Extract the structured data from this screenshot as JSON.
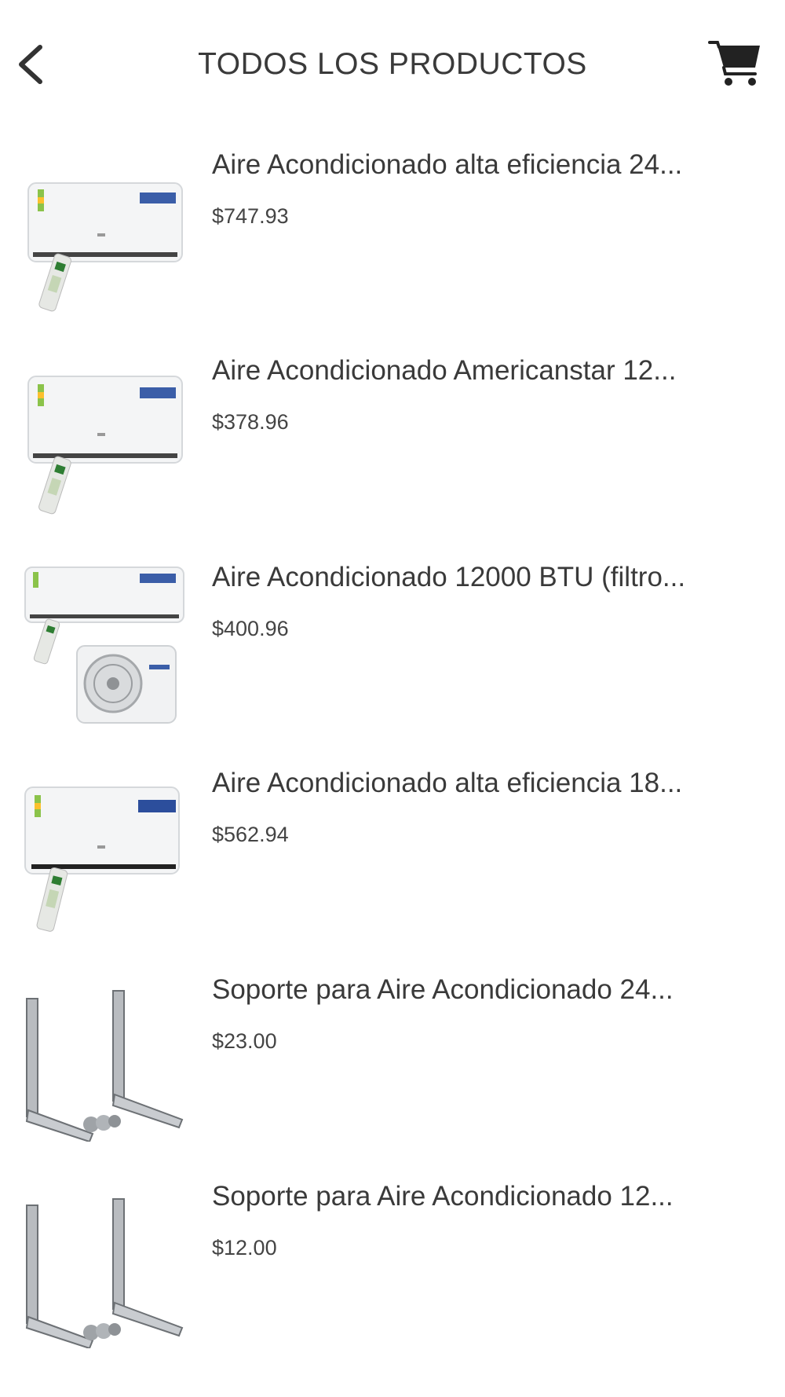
{
  "header": {
    "title": "TODOS LOS PRODUCTOS",
    "back_icon": "chevron-left-icon",
    "cart_icon": "cart-icon"
  },
  "products": [
    {
      "name": "Aire Acondicionado alta eficiencia 24...",
      "price": "$747.93",
      "image": "split-ac-with-remote"
    },
    {
      "name": "Aire Acondicionado Americanstar 12...",
      "price": "$378.96",
      "image": "split-ac-with-remote"
    },
    {
      "name": "Aire Acondicionado 12000 BTU (filtro...",
      "price": "$400.96",
      "image": "split-ac-with-outdoor-unit"
    },
    {
      "name": "Aire Acondicionado alta eficiencia 18...",
      "price": "$562.94",
      "image": "split-ac-with-remote"
    },
    {
      "name": "Soporte para Aire Acondicionado 24...",
      "price": "$23.00",
      "image": "wall-mount-brackets"
    },
    {
      "name": "Soporte para Aire Acondicionado 12...",
      "price": "$12.00",
      "image": "wall-mount-brackets"
    }
  ]
}
